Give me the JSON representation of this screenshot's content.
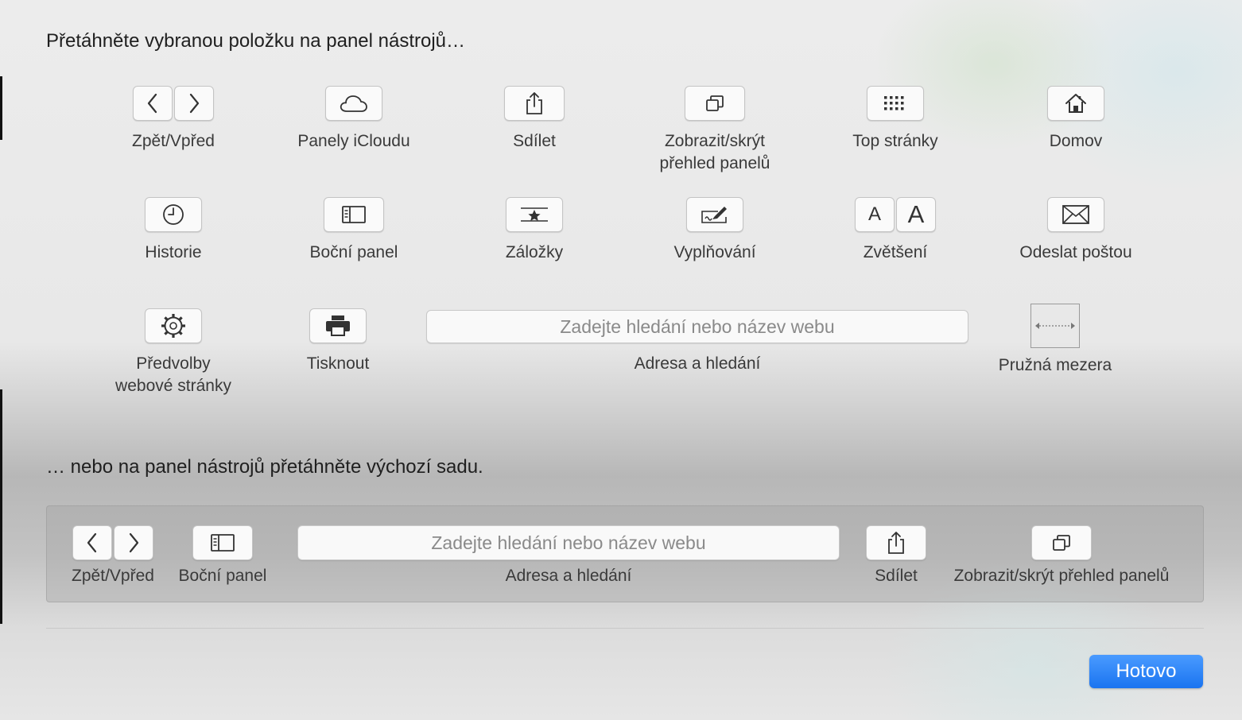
{
  "headings": {
    "drag_items": "Přetáhněte vybranou položku na panel nástrojů…",
    "drag_default": "… nebo na panel nástrojů přetáhněte výchozí sadu."
  },
  "items": {
    "back_forward": "Zpět/Vpřed",
    "icloud_tabs": "Panely iCloudu",
    "share": "Sdílet",
    "tab_overview_line1": "Zobrazit/skrýt",
    "tab_overview_line2": "přehled panelů",
    "top_sites": "Top stránky",
    "home": "Domov",
    "history": "Historie",
    "sidebar": "Boční panel",
    "bookmarks": "Záložky",
    "autofill": "Vyplňování",
    "zoom": "Zvětšení",
    "zoom_small_glyph": "A",
    "zoom_large_glyph": "A",
    "mail": "Odeslat poštou",
    "website_prefs_line1": "Předvolby",
    "website_prefs_line2": "webové stránky",
    "print": "Tisknout",
    "address": "Adresa a hledání",
    "address_placeholder": "Zadejte hledání nebo název webu",
    "flexible_space": "Pružná mezera"
  },
  "default_set": {
    "back_forward": "Zpět/Vpřed",
    "sidebar": "Boční panel",
    "address": "Adresa a hledání",
    "address_placeholder": "Zadejte hledání nebo název webu",
    "share": "Sdílet",
    "tab_overview": "Zobrazit/skrýt přehled panelů"
  },
  "done_button": "Hotovo",
  "colors": {
    "accent": "#1a74f0"
  },
  "icons": [
    "chevron-left-icon",
    "chevron-right-icon",
    "cloud-icon",
    "share-icon",
    "tabs-icon",
    "grid-icon",
    "home-icon",
    "clock-icon",
    "sidebar-icon",
    "bookmark-star-icon",
    "autofill-pencil-icon",
    "mail-icon",
    "gear-icon",
    "printer-icon",
    "flexible-space-arrow-icon"
  ]
}
